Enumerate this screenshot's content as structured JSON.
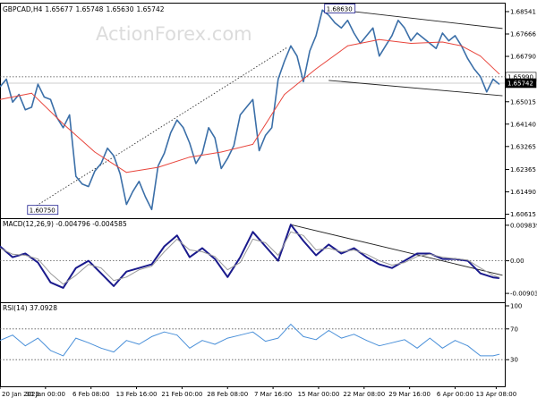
{
  "chart_data": [
    {
      "id": "price",
      "type": "line",
      "title": "GBPCAD,H4",
      "ohlc": {
        "open": "1.65677",
        "high": "1.65748",
        "low": "1.65630",
        "close": "1.65742"
      },
      "watermark": "ActionForex.com",
      "ylim": [
        1.606,
        1.6875
      ],
      "y_ticks": [
        "1.68541",
        "1.67666",
        "1.66790",
        "1.65915",
        "1.65015",
        "1.64140",
        "1.63265",
        "1.62365",
        "1.61490",
        "1.60615"
      ],
      "badges": [
        {
          "label": "1.68630",
          "x": 51.5,
          "y": 1.6863
        },
        {
          "label": "1.60750",
          "x": 4.5,
          "y": 1.6075
        }
      ],
      "price_tags": [
        {
          "label": "1.65990",
          "y": 1.6599,
          "style": "dotted"
        },
        {
          "label": "1.65742",
          "y": 1.65742,
          "style": "solid"
        }
      ],
      "series": [
        {
          "name": "",
          "role": "price",
          "color": "#3b6fa8",
          "x": [
            0,
            1,
            2,
            3,
            4,
            5,
            6,
            7,
            8,
            9,
            10,
            11,
            12,
            13,
            14,
            15,
            16,
            17,
            18,
            19,
            20,
            21,
            22,
            23,
            24,
            25,
            26,
            27,
            28,
            29,
            30,
            31,
            32,
            33,
            34,
            35,
            36,
            37,
            38,
            39,
            40,
            41,
            42,
            43,
            44,
            45,
            46,
            47,
            48,
            49,
            50,
            51,
            52,
            53,
            54,
            55,
            56,
            57,
            58,
            59,
            60,
            61,
            62,
            63,
            64,
            65,
            66,
            67,
            68,
            69,
            70,
            71,
            72,
            73,
            74,
            75,
            76,
            77,
            78,
            79
          ],
          "y": [
            1.656,
            1.659,
            1.65,
            1.653,
            1.647,
            1.648,
            1.657,
            1.652,
            1.651,
            1.644,
            1.64,
            1.645,
            1.621,
            1.618,
            1.617,
            1.623,
            1.626,
            1.632,
            1.629,
            1.622,
            1.61,
            1.615,
            1.619,
            1.613,
            1.608,
            1.625,
            1.63,
            1.638,
            1.643,
            1.64,
            1.634,
            1.626,
            1.63,
            1.64,
            1.636,
            1.624,
            1.628,
            1.633,
            1.645,
            1.648,
            1.651,
            1.631,
            1.637,
            1.64,
            1.659,
            1.666,
            1.672,
            1.668,
            1.658,
            1.67,
            1.676,
            1.686,
            1.684,
            1.681,
            1.679,
            1.682,
            1.677,
            1.673,
            1.676,
            1.679,
            1.668,
            1.672,
            1.676,
            1.682,
            1.679,
            1.674,
            1.677,
            1.675,
            1.673,
            1.671,
            1.677,
            1.674,
            1.676,
            1.672,
            1.667,
            1.663,
            1.66,
            1.654,
            1.659,
            1.657
          ]
        },
        {
          "name": "",
          "role": "ma",
          "color": "#e8453c",
          "x": [
            0,
            5,
            10,
            15,
            20,
            25,
            30,
            35,
            40,
            45,
            50,
            55,
            60,
            65,
            70,
            73,
            76,
            79
          ],
          "y": [
            1.651,
            1.6535,
            1.6415,
            1.6305,
            1.6225,
            1.6245,
            1.6285,
            1.6305,
            1.6335,
            1.653,
            1.663,
            1.672,
            1.6745,
            1.673,
            1.6735,
            1.672,
            1.668,
            1.661
          ]
        }
      ],
      "trendlines": [
        {
          "x": [
            4.5,
            45.5
          ],
          "y": [
            1.6075,
            1.6715
          ],
          "style": "dotted",
          "color": "#333333"
        },
        {
          "x": [
            52.5,
            79.5
          ],
          "y": [
            1.6864,
            1.6788
          ],
          "style": "solid",
          "color": "#222222"
        },
        {
          "x": [
            52.0,
            79.5
          ],
          "y": [
            1.6585,
            1.6525
          ],
          "style": "solid",
          "color": "#222222"
        }
      ]
    },
    {
      "id": "macd",
      "type": "line",
      "title": "MACD(12,26,9) -0.004796 -0.004585",
      "ylim": [
        -0.0105,
        0.0108
      ],
      "y_ticks": [
        "0.009839",
        "0.00",
        "-0.009036"
      ],
      "series": [
        {
          "name": "",
          "role": "macd",
          "color": "#1a1a8c",
          "x": [
            0,
            2,
            4,
            6,
            8,
            10,
            12,
            14,
            16,
            18,
            20,
            22,
            24,
            26,
            28,
            30,
            32,
            34,
            36,
            38,
            40,
            42,
            44,
            46,
            48,
            50,
            52,
            54,
            56,
            58,
            60,
            62,
            64,
            66,
            68,
            70,
            72,
            74,
            76,
            78,
            79
          ],
          "y": [
            0.004,
            0.001,
            0.002,
            -0.0005,
            -0.006,
            -0.0075,
            -0.002,
            0.0,
            -0.0035,
            -0.007,
            -0.003,
            -0.002,
            -0.001,
            0.004,
            0.007,
            0.001,
            0.0035,
            0.0005,
            -0.0045,
            0.001,
            0.008,
            0.004,
            0.0,
            0.01,
            0.0055,
            0.0015,
            0.0045,
            0.002,
            0.0035,
            0.001,
            -0.001,
            -0.002,
            0.0,
            0.002,
            0.002,
            0.0005,
            0.0005,
            0.0,
            -0.0035,
            -0.0046,
            -0.0048
          ]
        },
        {
          "name": "",
          "role": "signal",
          "color": "#9a9a9a",
          "x": [
            0,
            2,
            4,
            6,
            8,
            10,
            12,
            14,
            16,
            18,
            20,
            22,
            24,
            26,
            28,
            30,
            32,
            34,
            36,
            38,
            40,
            42,
            44,
            46,
            48,
            50,
            52,
            54,
            56,
            58,
            60,
            62,
            64,
            66,
            68,
            70,
            72,
            74,
            76,
            78,
            79
          ],
          "y": [
            0.0035,
            0.0018,
            0.0015,
            0.0005,
            -0.0035,
            -0.0065,
            -0.004,
            -0.001,
            -0.002,
            -0.0055,
            -0.0045,
            -0.0025,
            -0.0015,
            0.0025,
            0.006,
            0.003,
            0.0025,
            0.0012,
            -0.0025,
            -0.0005,
            0.006,
            0.005,
            0.0015,
            0.008,
            0.007,
            0.003,
            0.0035,
            0.0025,
            0.003,
            0.0018,
            0.0,
            -0.0012,
            -0.0005,
            0.0012,
            0.0018,
            0.001,
            0.0006,
            0.0002,
            -0.002,
            -0.004,
            -0.0046
          ]
        }
      ],
      "trendlines": [
        {
          "x": [
            46.0,
            79.5
          ],
          "y": [
            0.01,
            -0.004
          ],
          "style": "solid",
          "color": "#222222"
        }
      ]
    },
    {
      "id": "rsi",
      "type": "line",
      "title": "RSI(14) 37.0928",
      "ylim": [
        0,
        100
      ],
      "y_ticks": [
        "100",
        "70",
        "30"
      ],
      "levels": [
        70,
        30
      ],
      "series": [
        {
          "name": "",
          "role": "rsi",
          "color": "#4a90d9",
          "x": [
            0,
            2,
            4,
            6,
            8,
            10,
            12,
            14,
            16,
            18,
            20,
            22,
            24,
            26,
            28,
            30,
            32,
            34,
            36,
            38,
            40,
            42,
            44,
            46,
            48,
            50,
            52,
            54,
            56,
            58,
            60,
            62,
            64,
            66,
            68,
            70,
            72,
            74,
            76,
            78,
            79
          ],
          "y": [
            55,
            62,
            48,
            58,
            42,
            35,
            58,
            52,
            45,
            40,
            55,
            50,
            60,
            66,
            62,
            45,
            55,
            50,
            58,
            62,
            66,
            54,
            58,
            76,
            60,
            56,
            68,
            58,
            63,
            55,
            48,
            52,
            56,
            45,
            58,
            45,
            55,
            48,
            35,
            35,
            37
          ]
        }
      ]
    }
  ],
  "x_axis": {
    "labels": [
      "20 Jan 2023",
      "30 Jan 00:00",
      "6 Feb 08:00",
      "13 Feb 16:00",
      "21 Feb 00:00",
      "28 Feb 08:00",
      "7 Mar 16:00",
      "15 Mar 00:00",
      "22 Mar 08:00",
      "29 Mar 16:00",
      "6 Apr 00:00",
      "13 Apr 08:00"
    ],
    "positions": [
      0,
      7.2,
      14.4,
      21.6,
      28.8,
      36,
      43.2,
      50.4,
      57.6,
      64.8,
      72,
      78.5
    ],
    "range": [
      0,
      80
    ]
  }
}
